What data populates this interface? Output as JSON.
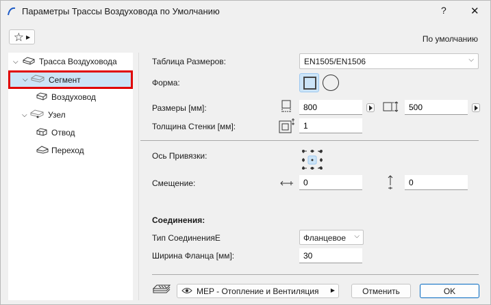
{
  "window": {
    "title": "Параметры Трассы Воздуховода по Умолчанию",
    "help": "?",
    "close": "✕"
  },
  "header": {
    "default_label": "По умолчанию"
  },
  "tree": [
    {
      "label": "Трасса Воздуховода",
      "level": 0,
      "expanded": true
    },
    {
      "label": "Сегмент",
      "level": 1,
      "expanded": true,
      "selected": true
    },
    {
      "label": "Воздуховод",
      "level": 2
    },
    {
      "label": "Узел",
      "level": 1,
      "expanded": true
    },
    {
      "label": "Отвод",
      "level": 2
    },
    {
      "label": "Переход",
      "level": 2
    }
  ],
  "form": {
    "size_table_label": "Таблица Размеров:",
    "size_table_value": "EN1505/EN1506",
    "shape_label": "Форма:",
    "dims_label": "Размеры [мм]:",
    "width": "800",
    "height": "500",
    "wall_label": "Толщина Стенки [мм]:",
    "wall": "1",
    "anchor_label": "Ось Привязки:",
    "offset_label": "Смещение:",
    "offset_x": "0",
    "offset_y": "0",
    "connections_heading": "Соединения:",
    "conn_type_label": "Тип СоединенияE",
    "conn_type_value": "Фланцевое",
    "flange_label": "Ширина Фланца [мм]:",
    "flange": "30"
  },
  "footer": {
    "layer": "MEP - Отопление и Вентиляция",
    "cancel": "Отменить",
    "ok": "OK"
  },
  "colors": {
    "selection": "#cce4f7",
    "highlight_box": "#e00000",
    "accent": "#0067c0"
  }
}
